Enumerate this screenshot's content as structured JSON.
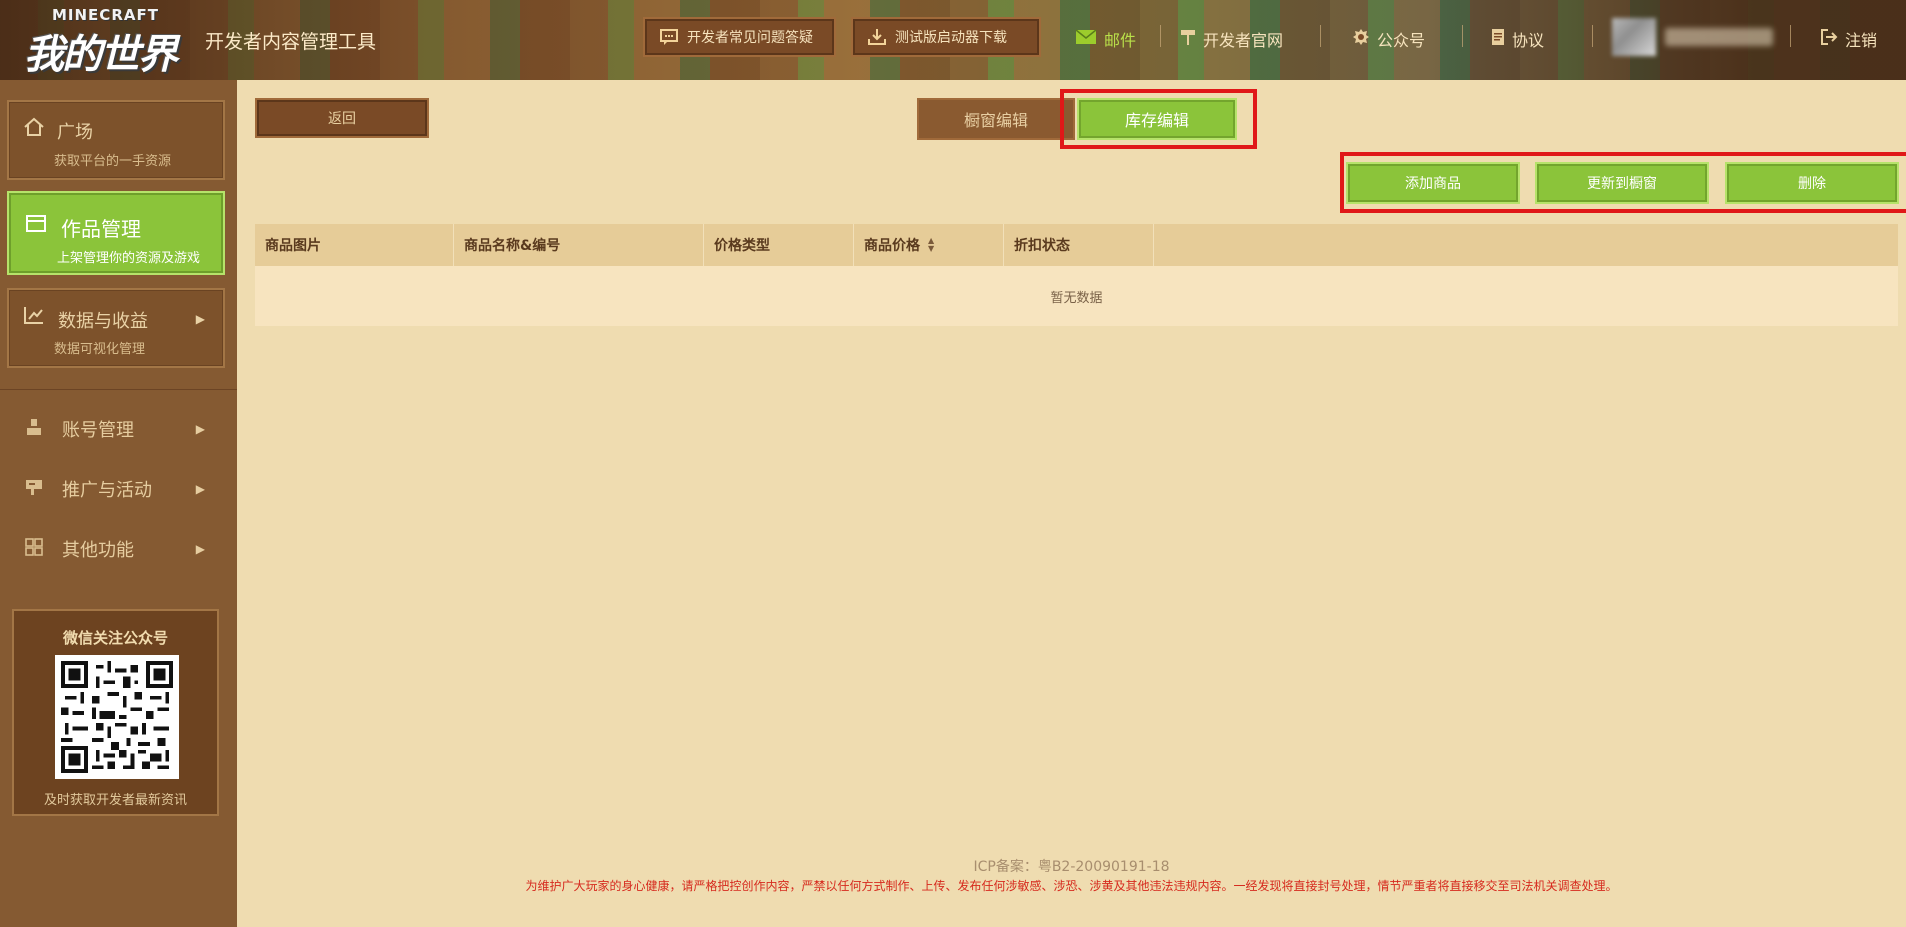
{
  "header": {
    "logo_top": "MINECRAFT",
    "logo_main": "我的世界",
    "app_title": "开发者内容管理工具",
    "faq_button": "开发者常见问题答疑",
    "download_button": "测试版启动器下载",
    "mail_link": "邮件",
    "devsite_link": "开发者官网",
    "wechat_link": "公众号",
    "protocol_link": "协议",
    "logout_link": "注销",
    "mail_color": "#9ccc2c"
  },
  "sidebar": {
    "home": {
      "title": "广场",
      "subtitle": "获取平台的一手资源"
    },
    "works": {
      "title": "作品管理",
      "subtitle": "上架管理你的资源及游戏"
    },
    "data": {
      "title": "数据与收益",
      "subtitle": "数据可视化管理"
    },
    "items": [
      {
        "label": "账号管理"
      },
      {
        "label": "推广与活动"
      },
      {
        "label": "其他功能"
      }
    ],
    "qr": {
      "title": "微信关注公众号",
      "subtitle": "及时获取开发者最新资讯"
    }
  },
  "main": {
    "back_button": "返回",
    "tabs": [
      {
        "label": "橱窗编辑",
        "active": false
      },
      {
        "label": "库存编辑",
        "active": true
      }
    ],
    "actions": {
      "add": "添加商品",
      "update": "更新到橱窗",
      "delete": "删除"
    },
    "table": {
      "columns": [
        "商品图片",
        "商品名称&编号",
        "价格类型",
        "商品价格",
        "折扣状态",
        ""
      ],
      "empty_text": "暂无数据"
    },
    "footer": {
      "icp": "ICP备案：粤B2-20090191-18",
      "warning": "为维护广大玩家的身心健康，请严格把控创作内容，严禁以任何方式制作、上传、发布任何涉敏感、涉恐、涉黄及其他违法违规内容。一经发现将直接封号处理，情节严重者将直接移交至司法机关调查处理。"
    },
    "accent_green": "#8bc43a",
    "highlight_red": "#e01818"
  }
}
